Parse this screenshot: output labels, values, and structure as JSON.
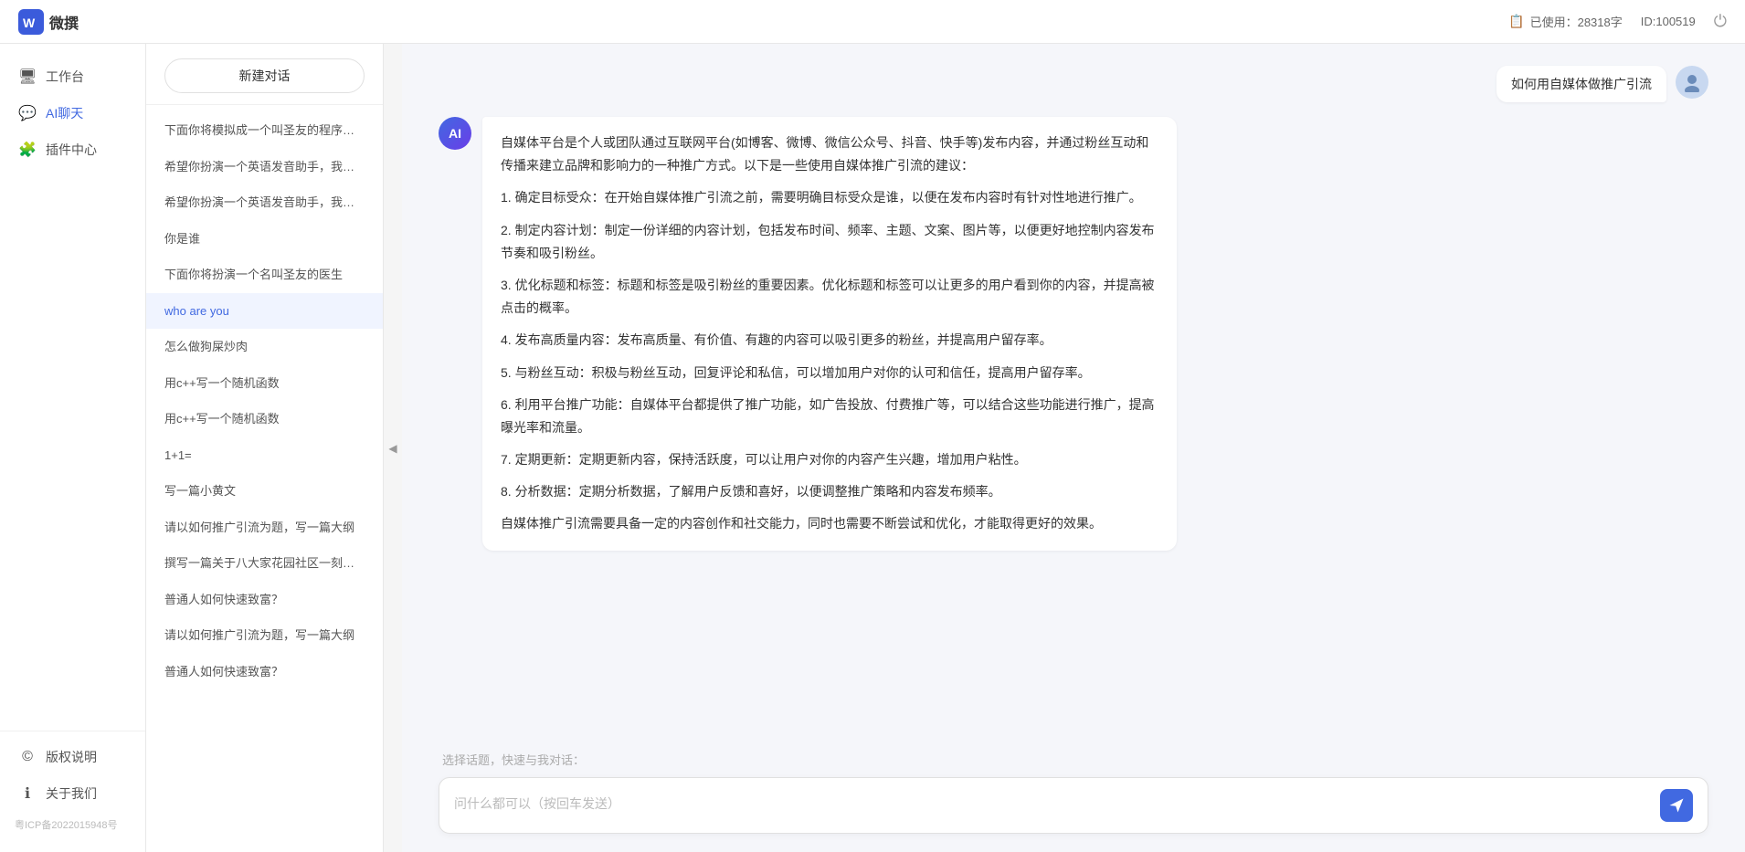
{
  "topbar": {
    "title": "微撰",
    "usage_label": "已使用：28318字",
    "id_label": "ID:100519",
    "usage_icon": "📋"
  },
  "sidebar": {
    "nav_items": [
      {
        "id": "workspace",
        "label": "工作台",
        "icon": "🖥"
      },
      {
        "id": "ai-chat",
        "label": "AI聊天",
        "icon": "💬",
        "active": true
      },
      {
        "id": "plugin",
        "label": "插件中心",
        "icon": "🧩"
      }
    ],
    "bottom_items": [
      {
        "id": "copyright",
        "label": "版权说明",
        "icon": "©"
      },
      {
        "id": "about",
        "label": "关于我们",
        "icon": "ℹ"
      }
    ],
    "icp": "粤ICP备2022015948号"
  },
  "history": {
    "new_chat_label": "新建对话",
    "items": [
      {
        "id": 1,
        "text": "下面你将模拟成一个叫圣友的程序员、我说...",
        "active": false
      },
      {
        "id": 2,
        "text": "希望你扮演一个英语发音助手，我提供给你...",
        "active": false
      },
      {
        "id": 3,
        "text": "希望你扮演一个英语发音助手，我提供给你...",
        "active": false
      },
      {
        "id": 4,
        "text": "你是谁",
        "active": false
      },
      {
        "id": 5,
        "text": "下面你将扮演一个名叫圣友的医生",
        "active": false
      },
      {
        "id": 6,
        "text": "who are you",
        "active": true
      },
      {
        "id": 7,
        "text": "怎么做狗屎炒肉",
        "active": false
      },
      {
        "id": 8,
        "text": "用c++写一个随机函数",
        "active": false
      },
      {
        "id": 9,
        "text": "用c++写一个随机函数",
        "active": false
      },
      {
        "id": 10,
        "text": "1+1=",
        "active": false
      },
      {
        "id": 11,
        "text": "写一篇小黄文",
        "active": false
      },
      {
        "id": 12,
        "text": "请以如何推广引流为题，写一篇大纲",
        "active": false
      },
      {
        "id": 13,
        "text": "撰写一篇关于八大家花园社区一刻钟便民生...",
        "active": false
      },
      {
        "id": 14,
        "text": "普通人如何快速致富？",
        "active": false
      },
      {
        "id": 15,
        "text": "请以如何推广引流为题，写一篇大纲",
        "active": false
      },
      {
        "id": 16,
        "text": "普通人如何快速致富？",
        "active": false
      }
    ]
  },
  "chat": {
    "user_question": "如何用自媒体做推广引流",
    "ai_response": {
      "paragraphs": [
        "自媒体平台是个人或团队通过互联网平台(如博客、微博、微信公众号、抖音、快手等)发布内容，并通过粉丝互动和传播来建立品牌和影响力的一种推广方式。以下是一些使用自媒体推广引流的建议：",
        "1. 确定目标受众：在开始自媒体推广引流之前，需要明确目标受众是谁，以便在发布内容时有针对性地进行推广。",
        "2. 制定内容计划：制定一份详细的内容计划，包括发布时间、频率、主题、文案、图片等，以便更好地控制内容发布节奏和吸引粉丝。",
        "3. 优化标题和标签：标题和标签是吸引粉丝的重要因素。优化标题和标签可以让更多的用户看到你的内容，并提高被点击的概率。",
        "4. 发布高质量内容：发布高质量、有价值、有趣的内容可以吸引更多的粉丝，并提高用户留存率。",
        "5. 与粉丝互动：积极与粉丝互动，回复评论和私信，可以增加用户对你的认可和信任，提高用户留存率。",
        "6. 利用平台推广功能：自媒体平台都提供了推广功能，如广告投放、付费推广等，可以结合这些功能进行推广，提高曝光率和流量。",
        "7. 定期更新：定期更新内容，保持活跃度，可以让用户对你的内容产生兴趣，增加用户粘性。",
        "8. 分析数据：定期分析数据，了解用户反馈和喜好，以便调整推广策略和内容发布频率。",
        "自媒体推广引流需要具备一定的内容创作和社交能力，同时也需要不断尝试和优化，才能取得更好的效果。"
      ]
    },
    "quick_topics_label": "选择话题，快速与我对话：",
    "input_placeholder": "问什么都可以（按回车发送）"
  }
}
